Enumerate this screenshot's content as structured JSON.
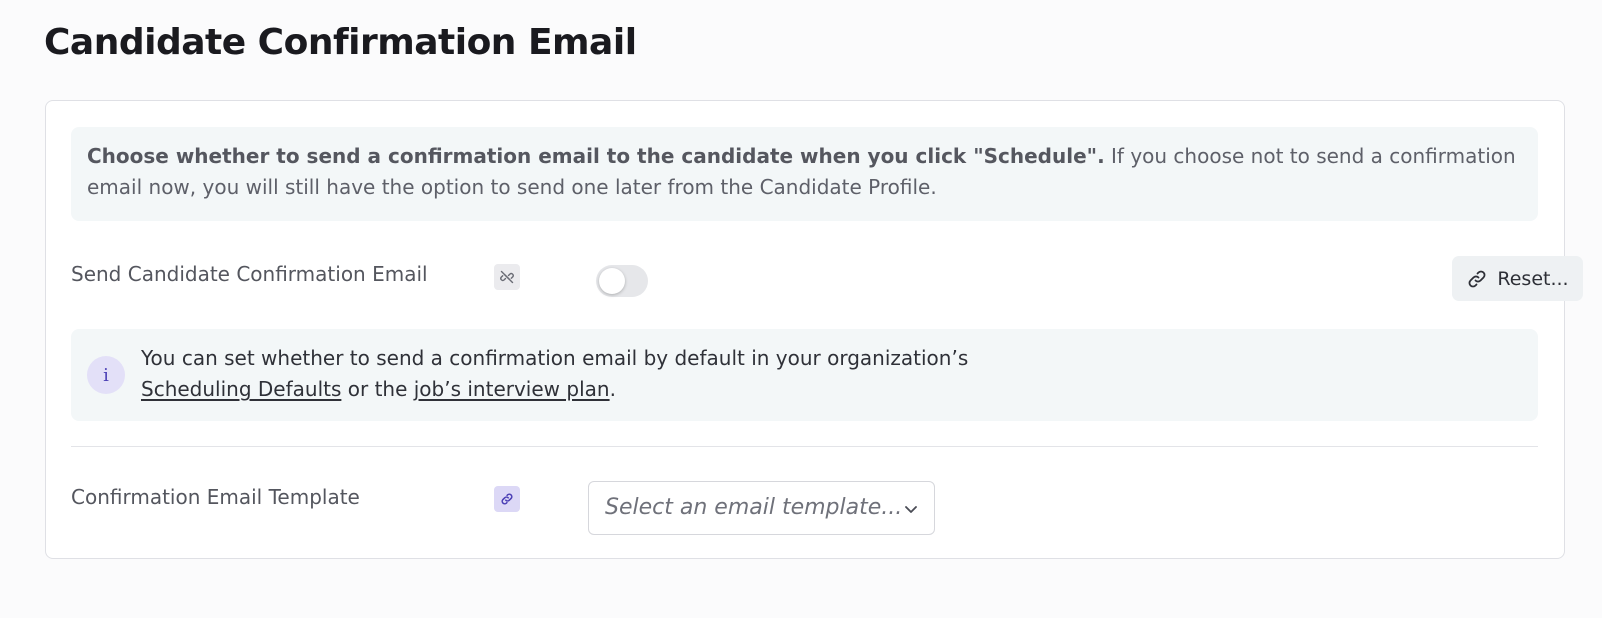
{
  "page": {
    "title": "Candidate Confirmation Email"
  },
  "intro": {
    "strong": "Choose whether to send a confirmation email to the candidate when you click \"Schedule\".",
    "rest": " If you choose not to send a confirmation email now, you will still have the option to send one later from the Candidate Profile."
  },
  "send_setting": {
    "label": "Send Candidate Confirmation Email",
    "inherit_icon": "unlinked-chain-icon",
    "toggle_on": false,
    "reset_label": "Reset...",
    "reset_icon": "link-icon"
  },
  "info": {
    "icon": "info-icon",
    "icon_glyph": "i",
    "text_before": "You can set whether to send a confirmation email by default in your organization’s ",
    "link_defaults": "Scheduling Defaults",
    "text_middle": " or the ",
    "link_plan": "job’s interview plan",
    "text_after": "."
  },
  "template_setting": {
    "label": "Confirmation Email Template",
    "inherit_icon": "linked-chain-icon",
    "select_placeholder": "Select an email template...",
    "select_icon": "chevron-down-icon"
  },
  "colors": {
    "accent": "#4b3fb5",
    "linked_badge": "#dcd8f6",
    "info_background": "#f3f7f8"
  }
}
